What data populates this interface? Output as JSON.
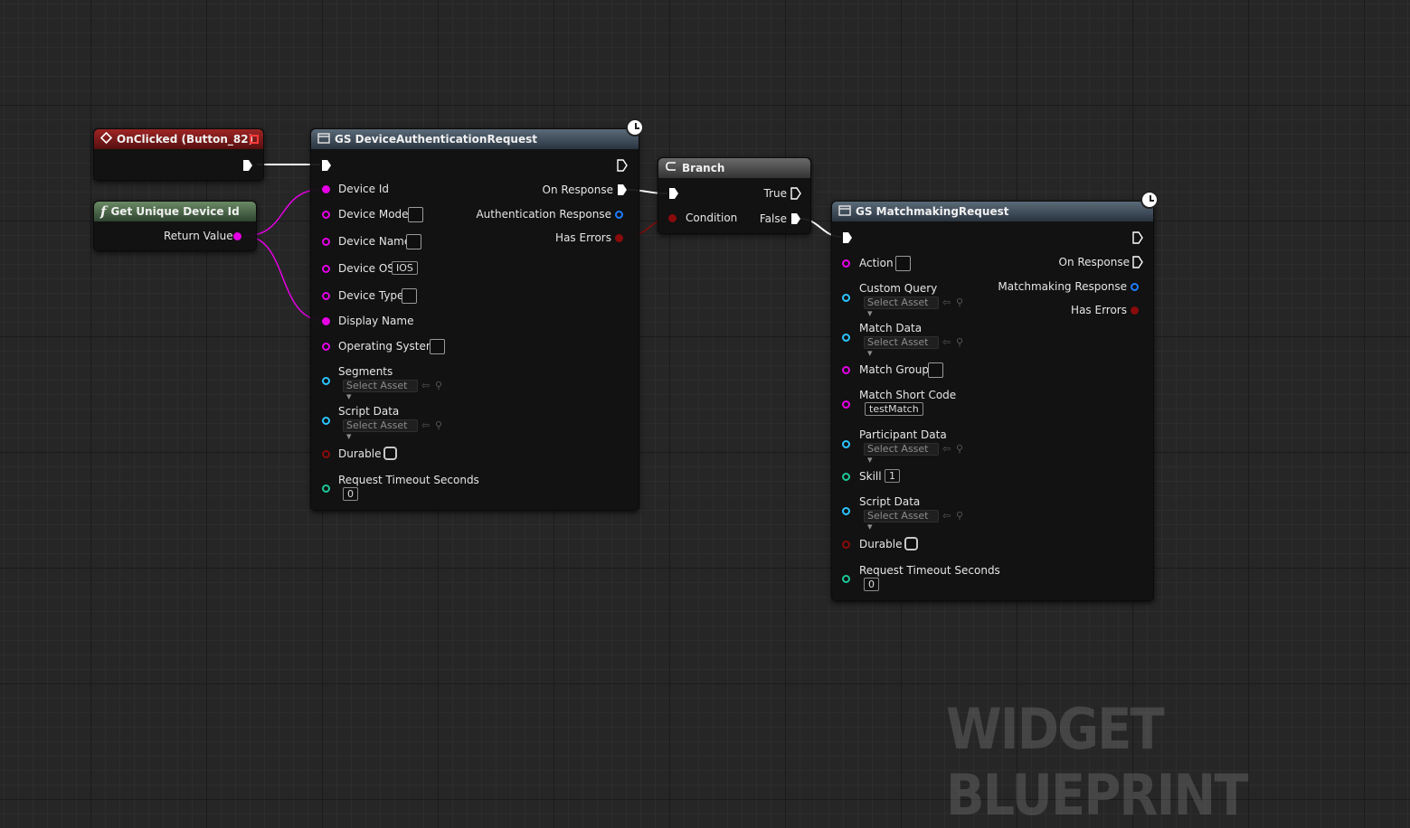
{
  "watermark": "WIDGET BLUEPRINT",
  "colors": {
    "string_pin": "#e600e6",
    "object_pin": "#1f7dff",
    "bool_pin": "#8a0b0b",
    "float_pin": "#1ec79a",
    "exec_pin": "#ffffff"
  },
  "nodes": {
    "onclicked": {
      "title": "OnClicked (Button_82)",
      "icon": "event-diamond-icon"
    },
    "get_device_id": {
      "title": "Get Unique Device Id",
      "icon": "function-icon",
      "return_label": "Return Value"
    },
    "device_auth": {
      "title": "GS DeviceAuthenticationRequest",
      "icon": "class-icon",
      "inputs": {
        "device_id": "Device Id",
        "device_model": "Device Model",
        "device_name": "Device Name",
        "device_os": "Device OS",
        "device_os_value": "IOS",
        "device_type": "Device Type",
        "display_name": "Display Name",
        "operating_system": "Operating System",
        "segments": "Segments",
        "script_data": "Script Data",
        "durable": "Durable",
        "timeout": "Request Timeout Seconds",
        "timeout_value": "0",
        "select_asset": "Select Asset"
      },
      "outputs": {
        "on_response": "On Response",
        "auth_response": "Authentication Response",
        "has_errors": "Has Errors"
      }
    },
    "branch": {
      "title": "Branch",
      "condition": "Condition",
      "true_label": "True",
      "false_label": "False"
    },
    "matchmaking": {
      "title": "GS MatchmakingRequest",
      "inputs": {
        "action": "Action",
        "custom_query": "Custom Query",
        "match_data": "Match Data",
        "match_group": "Match Group",
        "match_short_code": "Match Short Code",
        "match_short_code_value": "testMatch",
        "participant_data": "Participant Data",
        "skill": "Skill",
        "skill_value": "1",
        "script_data": "Script Data",
        "durable": "Durable",
        "timeout": "Request Timeout Seconds",
        "timeout_value": "0",
        "select_asset": "Select Asset"
      },
      "outputs": {
        "on_response": "On Response",
        "mm_response": "Matchmaking Response",
        "has_errors": "Has Errors"
      }
    }
  }
}
